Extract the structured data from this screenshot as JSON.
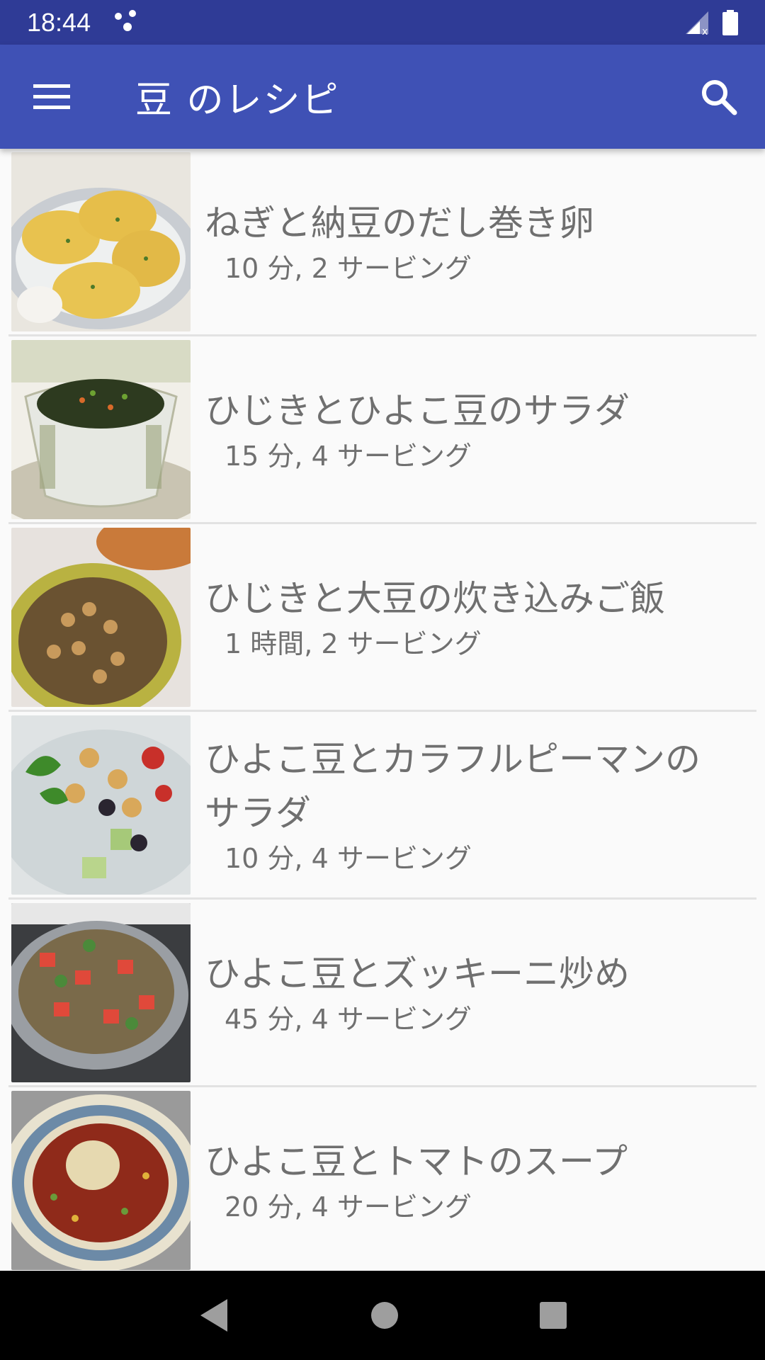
{
  "status_bar": {
    "time": "18:44"
  },
  "app_bar": {
    "title": "豆 のレシピ"
  },
  "recipes": [
    {
      "title": "ねぎと納豆のだし巻き卵",
      "meta": "10 分, 2 サービング"
    },
    {
      "title": "ひじきとひよこ豆のサラダ",
      "meta": "15 分, 4 サービング"
    },
    {
      "title": "ひじきと大豆の炊き込みご飯",
      "meta": "1 時間, 2 サービング"
    },
    {
      "title_line1": "ひよこ豆とカラフルピーマンの",
      "title_line2": "サラダ",
      "meta": "10 分, 4 サービング"
    },
    {
      "title": "ひよこ豆とズッキーニ炒め",
      "meta": "45 分, 4 サービング"
    },
    {
      "title": "ひよこ豆とトマトのスープ",
      "meta": "20 分, 4 サービング"
    }
  ],
  "colors": {
    "status_bar": "#2f3b96",
    "app_bar": "#3f51b5",
    "background": "#fafafa"
  }
}
